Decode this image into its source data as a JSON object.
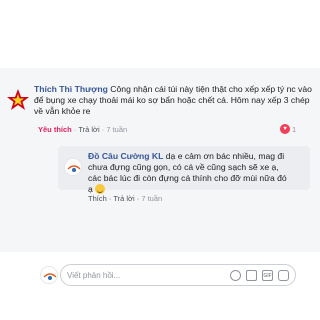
{
  "comment": {
    "author": "Thích Thì Thượng",
    "text": " Công nhận cái túi này tiện thật cho xếp xếp tý nc vào để bụng xe chạy thoải mái ko sợ bẩn hoặc chết cá. Hôm nay xếp 3 chép về vẫn khỏe re",
    "like_label": "Yêu thích",
    "reply_label": "Trả lời",
    "time": "7 tuần",
    "reaction_count": "1"
  },
  "reply": {
    "author": "Đồ Câu Cường KL",
    "text": " dạ e cảm ơn bác nhiều, mag đi chưa đựng cũng gọn, có cá về cũng sạch sẽ xe ạ, các bác lúc đi còn đựng cá thính cho đỡ mùi nữa đó ạ ",
    "like_label": "Thích",
    "reply_label": "Trả lời",
    "time": "7 tuần"
  },
  "composer": {
    "placeholder": "Viết phản hồi..."
  },
  "icons": {
    "emoji": "emoji-icon",
    "camera": "camera-icon",
    "gif": "gif-icon",
    "sticker": "sticker-icon"
  },
  "gif_label": "GIF"
}
